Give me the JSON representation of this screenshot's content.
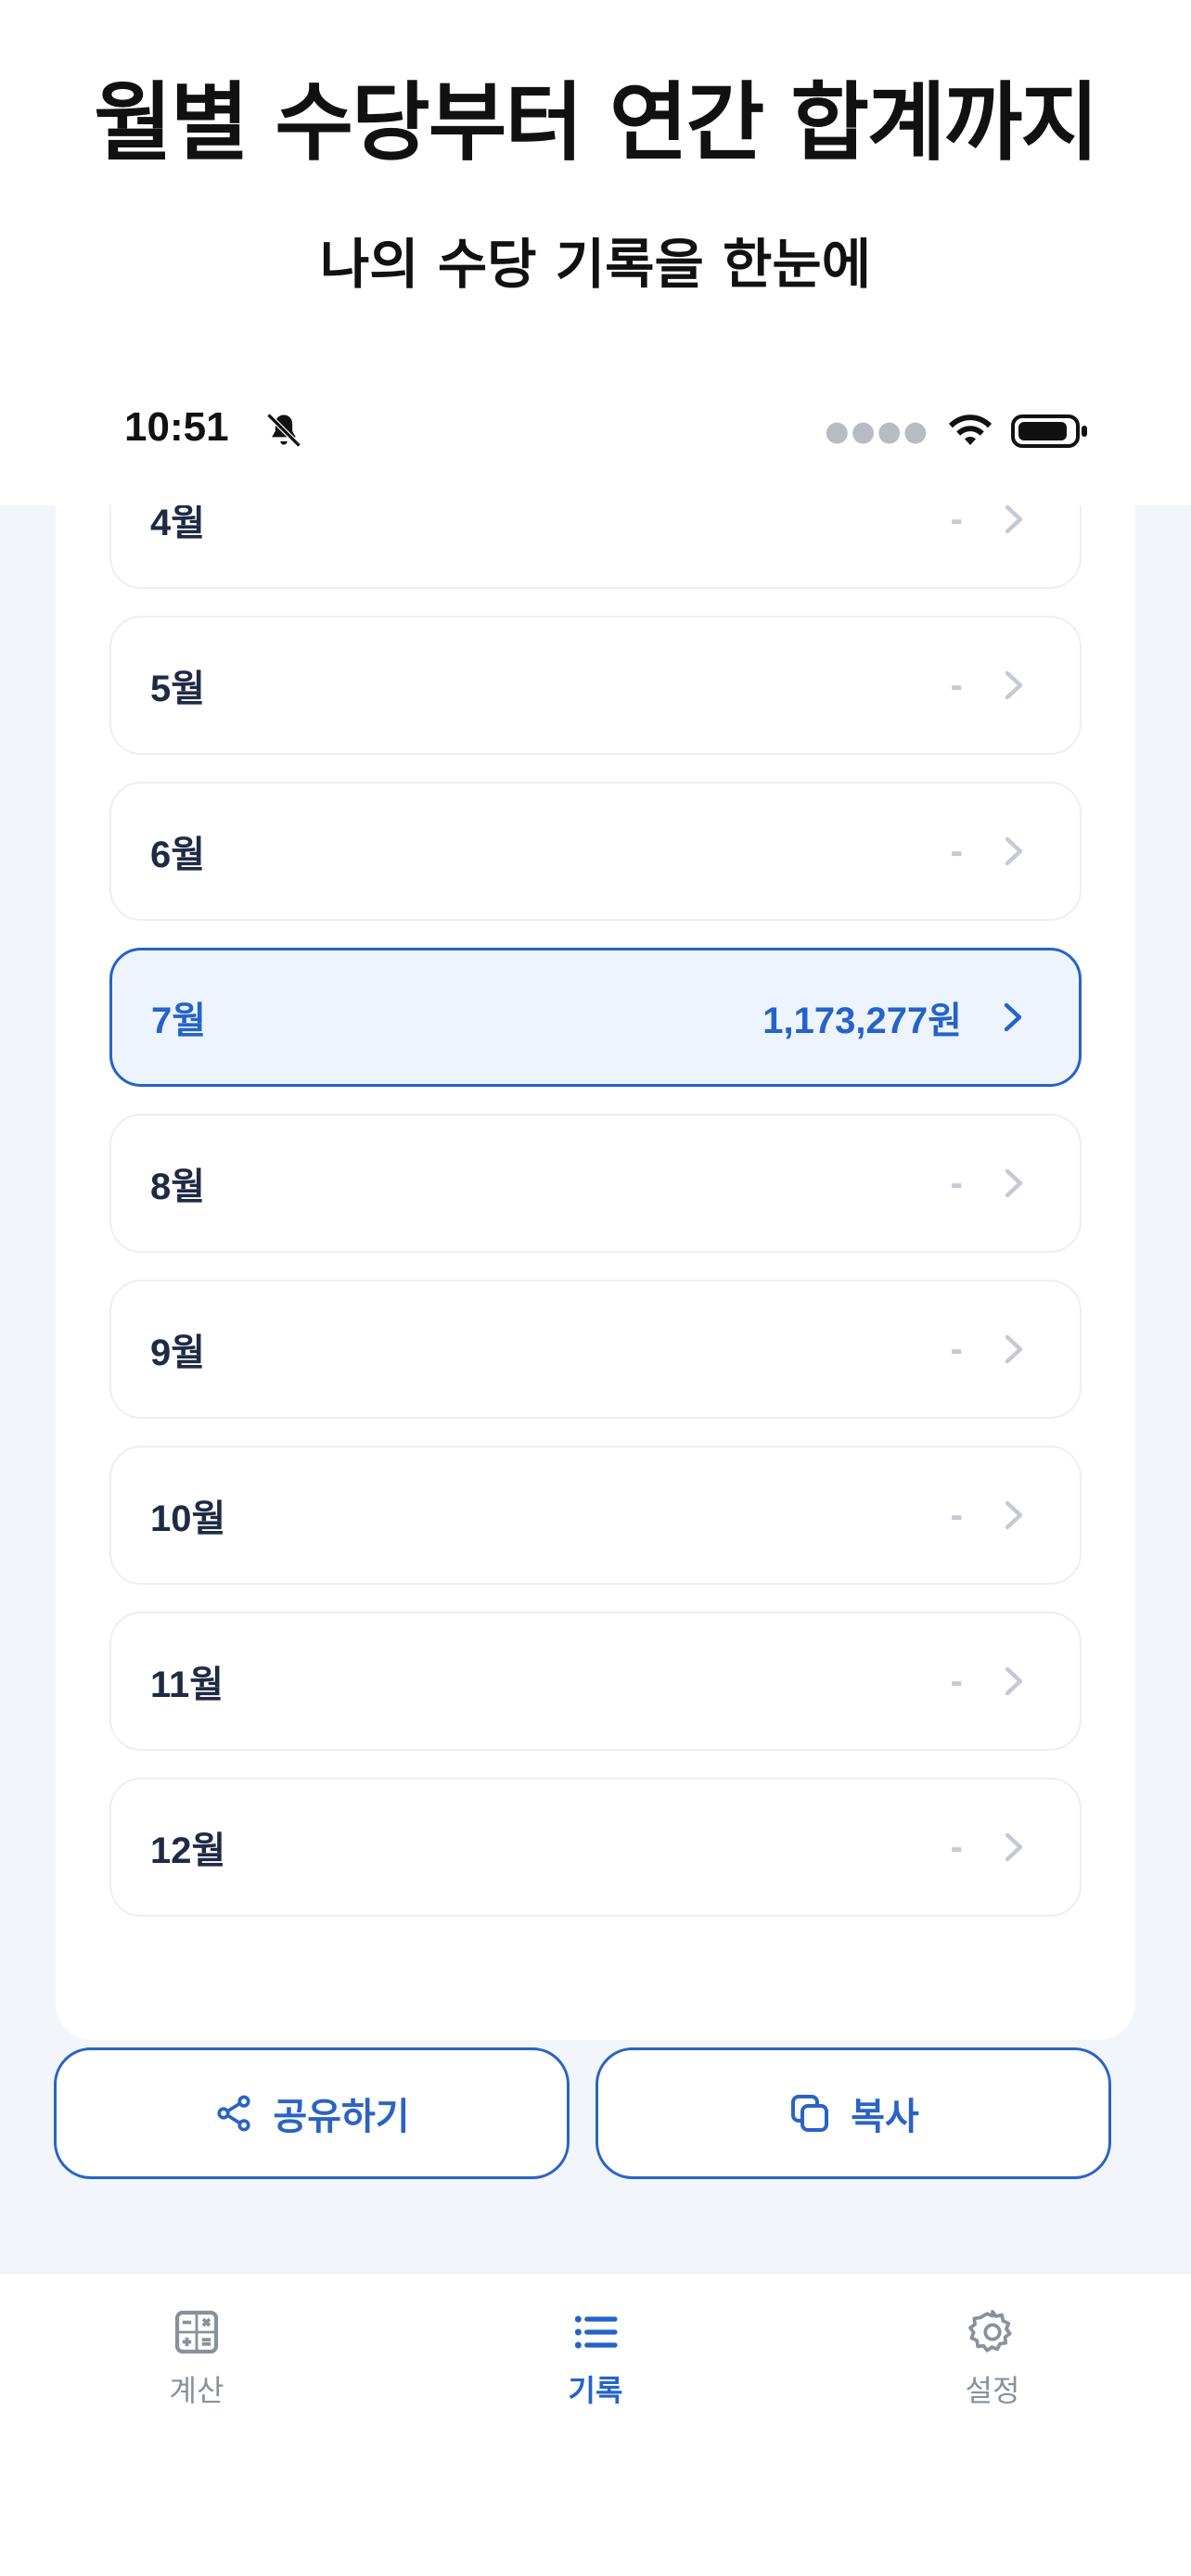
{
  "promo": {
    "title": "월별 수당부터 연간 합계까지",
    "subtitle": "나의 수당 기록을 한눈에"
  },
  "status_bar": {
    "time": "10:51",
    "icons": [
      "bell-off-icon",
      "signal-dots-icon",
      "wifi-icon",
      "battery-icon"
    ]
  },
  "months": [
    {
      "label": "4월",
      "amount": "-"
    },
    {
      "label": "5월",
      "amount": "-"
    },
    {
      "label": "6월",
      "amount": "-"
    },
    {
      "label": "7월",
      "amount": "1,173,277원"
    },
    {
      "label": "8월",
      "amount": "-"
    },
    {
      "label": "9월",
      "amount": "-"
    },
    {
      "label": "10월",
      "amount": "-"
    },
    {
      "label": "11월",
      "amount": "-"
    },
    {
      "label": "12월",
      "amount": "-"
    }
  ],
  "active_month": "7월",
  "actions": {
    "share_label": "공유하기",
    "copy_label": "복사"
  },
  "tabs": [
    {
      "label": "계산",
      "icon": "calculator-icon"
    },
    {
      "label": "기록",
      "icon": "list-icon"
    },
    {
      "label": "설정",
      "icon": "gear-icon"
    }
  ],
  "colors": {
    "accent": "#2563c9",
    "background": "#f2f5f9",
    "muted": "#c4c9d2"
  }
}
